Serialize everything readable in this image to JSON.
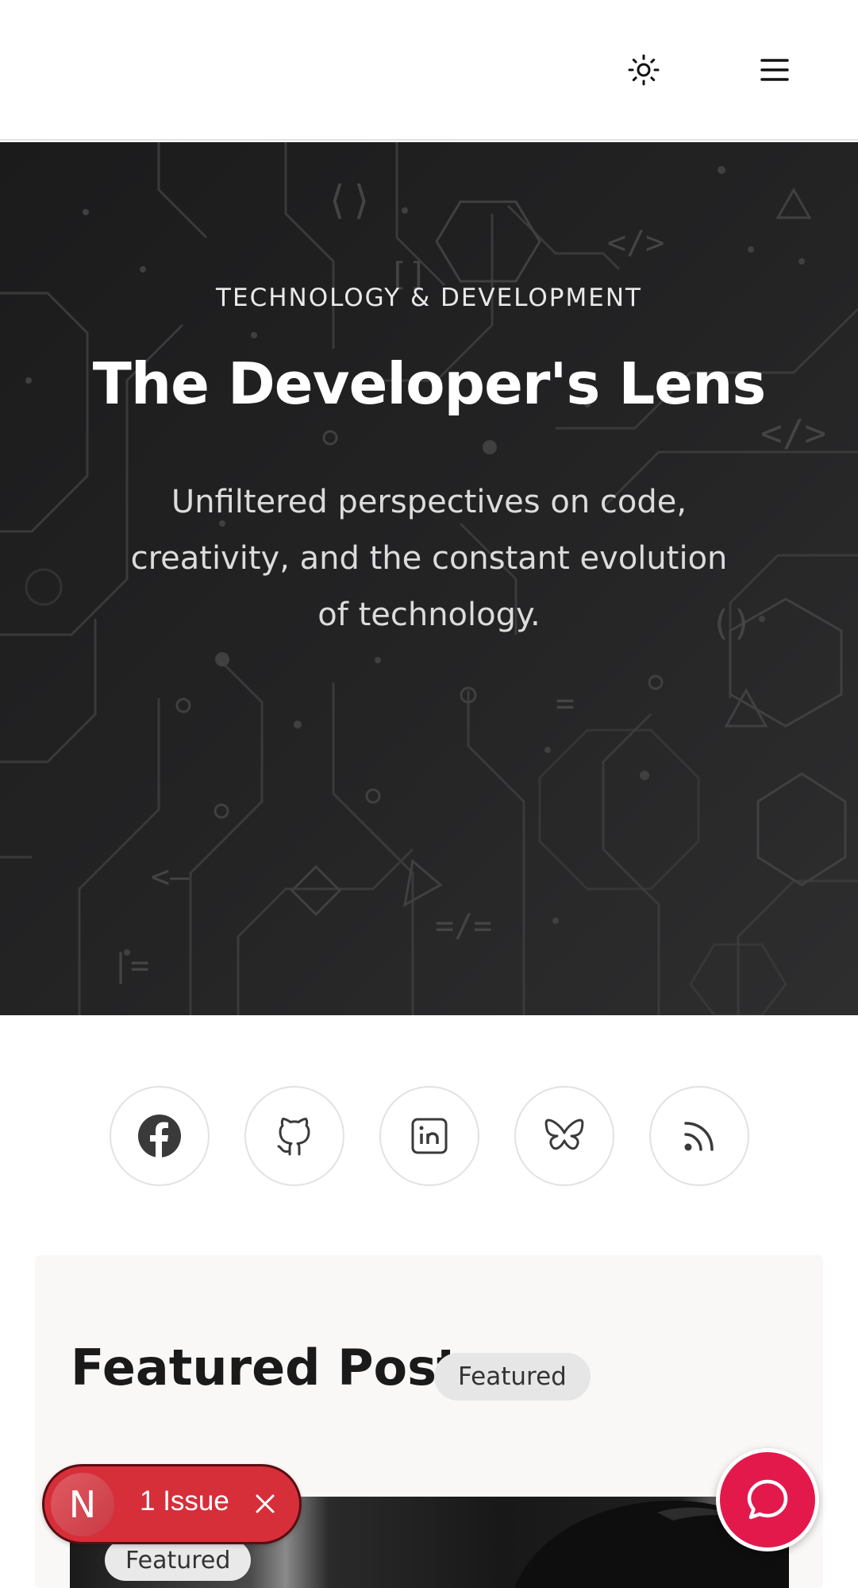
{
  "header": {
    "theme_icon": "sun-icon",
    "menu_icon": "hamburger-menu-icon"
  },
  "hero": {
    "eyebrow": "TECHNOLOGY & DEVELOPMENT",
    "title": "The Developer's Lens",
    "subtitle": "Unfiltered perspectives on code, creativity, and the constant evolution of technology."
  },
  "socials": [
    {
      "name": "facebook",
      "icon": "facebook-icon"
    },
    {
      "name": "github",
      "icon": "github-icon"
    },
    {
      "name": "linkedin",
      "icon": "linkedin-icon"
    },
    {
      "name": "bluesky",
      "icon": "butterfly-icon"
    },
    {
      "name": "rss",
      "icon": "rss-icon"
    }
  ],
  "featured": {
    "title": "Featured Post",
    "tag": "Featured",
    "image_tag": "Featured"
  },
  "issue_badge": {
    "letter": "N",
    "text": "1 Issue",
    "color": "#d62f3a"
  },
  "chat": {
    "icon": "chat-bubble-icon",
    "color": "#e3194c"
  }
}
